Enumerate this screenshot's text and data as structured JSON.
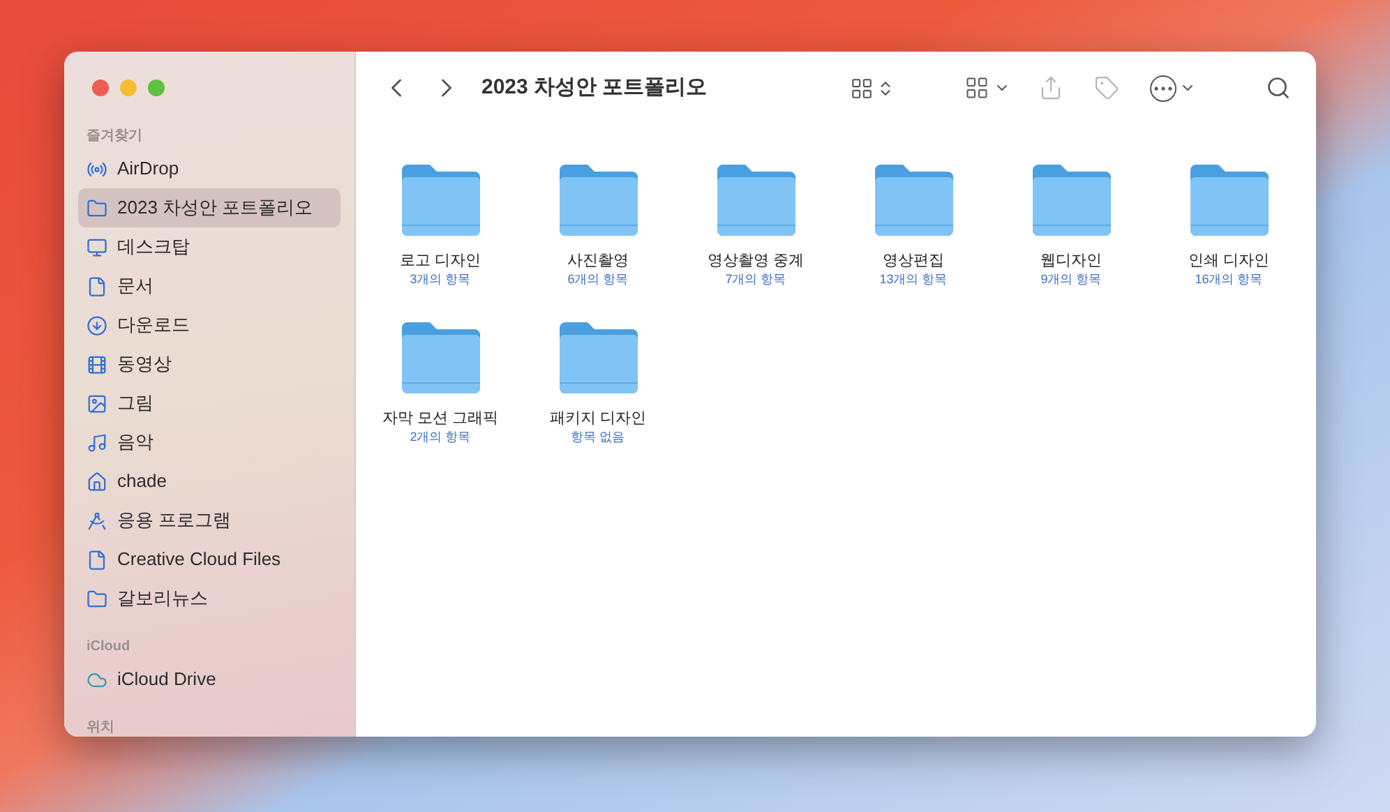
{
  "sidebar": {
    "sections": [
      {
        "header": "즐겨찾기",
        "items": [
          {
            "label": "AirDrop",
            "selected": false
          },
          {
            "label": "2023 차성안 포트폴리오",
            "selected": true
          },
          {
            "label": "데스크탑",
            "selected": false
          },
          {
            "label": "문서",
            "selected": false
          },
          {
            "label": "다운로드",
            "selected": false
          },
          {
            "label": "동영상",
            "selected": false
          },
          {
            "label": "그림",
            "selected": false
          },
          {
            "label": "음악",
            "selected": false
          },
          {
            "label": "chade",
            "selected": false
          },
          {
            "label": "응용 프로그램",
            "selected": false
          },
          {
            "label": "Creative Cloud Files",
            "selected": false
          },
          {
            "label": "갈보리뉴스",
            "selected": false
          }
        ]
      },
      {
        "header": "iCloud",
        "items": [
          {
            "label": "iCloud Drive",
            "selected": false
          }
        ]
      },
      {
        "header": "위치"
      }
    ]
  },
  "toolbar": {
    "title": "2023 차성안 포트폴리오"
  },
  "folders": [
    {
      "name": "로고 디자인",
      "count": "3개의 항목"
    },
    {
      "name": "사진촬영",
      "count": "6개의 항목"
    },
    {
      "name": "영상촬영 중계",
      "count": "7개의 항목"
    },
    {
      "name": "영상편집",
      "count": "13개의 항목"
    },
    {
      "name": "웹디자인",
      "count": "9개의 항목"
    },
    {
      "name": "인쇄 디자인",
      "count": "16개의 항목"
    },
    {
      "name": "자막 모션 그래픽",
      "count": "2개의 항목"
    },
    {
      "name": "패키지 디자인",
      "count": "항목 없음"
    }
  ]
}
